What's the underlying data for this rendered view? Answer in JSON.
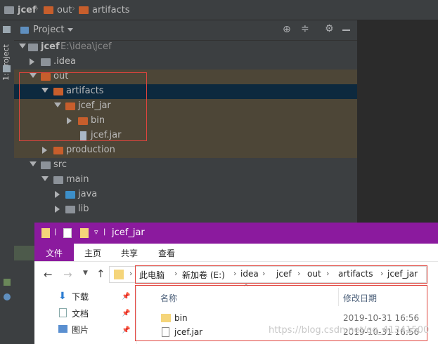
{
  "ide": {
    "breadcrumb": [
      "jcef",
      "out",
      "artifacts"
    ],
    "side_tab": "1: Project",
    "panel_title": "Project",
    "tree": [
      {
        "label": "jcef",
        "path": "E:\\idea\\jcef"
      },
      {
        "label": ".idea"
      },
      {
        "label": "out"
      },
      {
        "label": "artifacts"
      },
      {
        "label": "jcef_jar"
      },
      {
        "label": "bin"
      },
      {
        "label": "jcef.jar"
      },
      {
        "label": "production"
      },
      {
        "label": "src"
      },
      {
        "label": "main"
      },
      {
        "label": "java"
      },
      {
        "label": "lib"
      }
    ]
  },
  "explorer": {
    "title": "jcef_jar",
    "ribbon_tabs": [
      "文件",
      "主页",
      "共享",
      "查看"
    ],
    "address": [
      "此电脑",
      "新加卷 (E:)",
      "idea",
      "jcef",
      "out",
      "artifacts",
      "jcef_jar"
    ],
    "nav_items": [
      "下载",
      "文档",
      "图片"
    ],
    "columns": {
      "name": "名称",
      "modified": "修改日期"
    },
    "files": [
      {
        "name": "bin",
        "date": "2019-10-31 16:56"
      },
      {
        "name": "jcef.jar",
        "date": "2019-10-31 16:56"
      }
    ]
  },
  "watermark": "https://blog.csdn.net/qq_41341500"
}
